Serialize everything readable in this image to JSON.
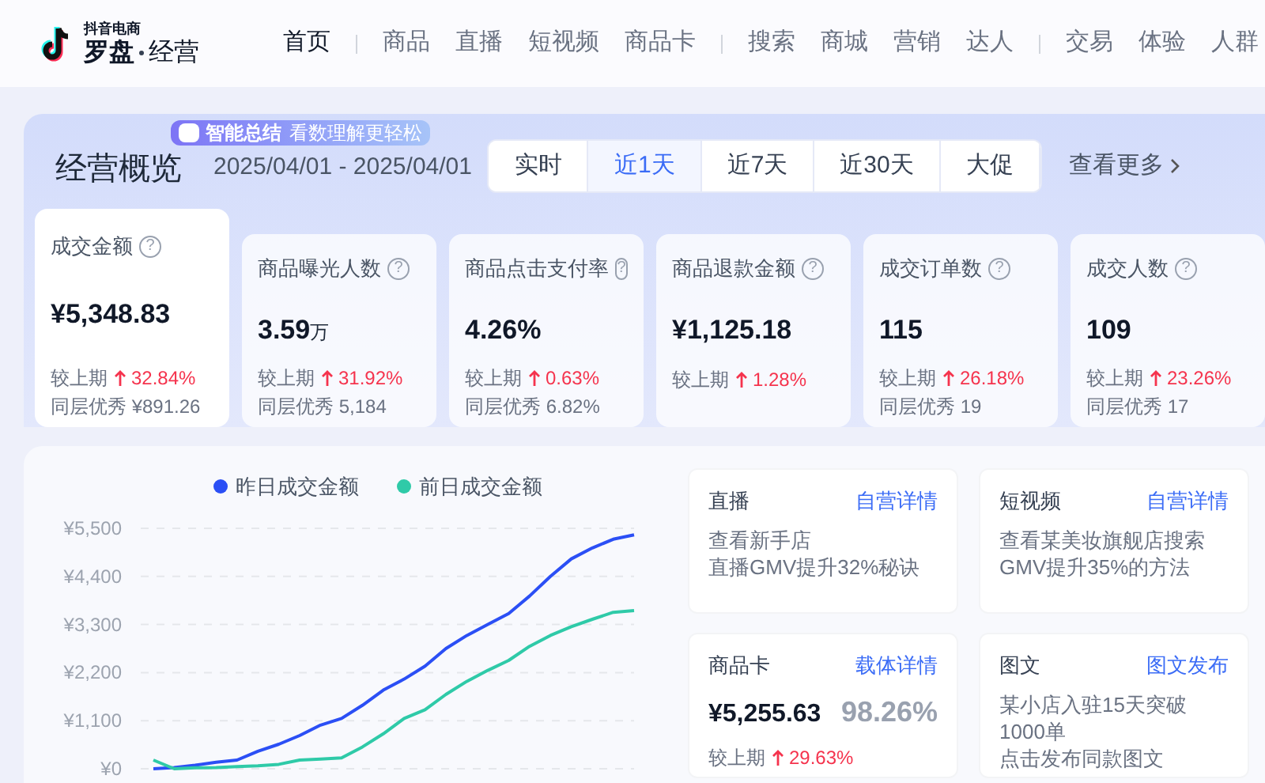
{
  "logo": {
    "top": "抖音电商",
    "main": "罗盘",
    "sub": "经营"
  },
  "nav_groups": [
    {
      "items": [
        {
          "label": "首页",
          "selected": true
        }
      ]
    },
    {
      "items": [
        {
          "label": "商品",
          "selected": false
        },
        {
          "label": "直播",
          "selected": false
        },
        {
          "label": "短视频",
          "selected": false
        },
        {
          "label": "商品卡",
          "selected": false
        }
      ]
    },
    {
      "items": [
        {
          "label": "搜索",
          "selected": false
        },
        {
          "label": "商城",
          "selected": false
        },
        {
          "label": "营销",
          "selected": false
        },
        {
          "label": "达人",
          "selected": false
        }
      ]
    },
    {
      "items": [
        {
          "label": "交易",
          "selected": false
        },
        {
          "label": "体验",
          "selected": false
        },
        {
          "label": "人群",
          "selected": false
        }
      ]
    }
  ],
  "overview": {
    "title": "经营概览",
    "badge": {
      "label": "智能总结",
      "hint": "看数理解更轻松"
    },
    "date_range": "2025/04/01 - 2025/04/01",
    "ranges": [
      {
        "label": "实时",
        "selected": false
      },
      {
        "label": "近1天",
        "selected": true
      },
      {
        "label": "近7天",
        "selected": false
      },
      {
        "label": "近30天",
        "selected": false
      },
      {
        "label": "大促",
        "selected": false
      }
    ],
    "more": "查看更多",
    "metrics": [
      {
        "label": "成交金额",
        "help": "?",
        "value": "¥5,348.83",
        "selected": true,
        "compare": "较上期",
        "change": "32.84%",
        "peer": "同层优秀 ¥891.26"
      },
      {
        "label": "商品曝光人数",
        "help": "?",
        "value": "3.59",
        "unit": "万",
        "selected": false,
        "compare": "较上期",
        "change": "31.92%",
        "peer": "同层优秀 5,184"
      },
      {
        "label": "商品点击支付率",
        "help": "?",
        "value": "4.26%",
        "selected": false,
        "compare": "较上期",
        "change": "0.63%",
        "peer": "同层优秀 6.82%"
      },
      {
        "label": "商品退款金额",
        "help": "?",
        "value": "¥1,125.18",
        "selected": false,
        "compare": "较上期",
        "change": "1.28%"
      },
      {
        "label": "成交订单数",
        "help": "?",
        "value": "115",
        "selected": false,
        "compare": "较上期",
        "change": "26.18%",
        "peer": "同层优秀 19"
      },
      {
        "label": "成交人数",
        "help": "?",
        "value": "109",
        "selected": false,
        "compare": "较上期",
        "change": "23.26%",
        "peer": "同层优秀 17"
      }
    ]
  },
  "chart_data": {
    "type": "line",
    "grid": true,
    "ylim": [
      0,
      5500
    ],
    "yticks": [
      {
        "value": 0,
        "label": "¥0"
      },
      {
        "value": 1100,
        "label": "¥1,100"
      },
      {
        "value": 2200,
        "label": "¥2,200"
      },
      {
        "value": 3300,
        "label": "¥3,300"
      },
      {
        "value": 4400,
        "label": "¥4,400"
      },
      {
        "value": 5500,
        "label": "¥5,500"
      }
    ],
    "series": [
      {
        "name": "昨日成交金额",
        "color": "#2b4ff5",
        "values": [
          0,
          30,
          80,
          150,
          200,
          400,
          560,
          760,
          1000,
          1150,
          1450,
          1800,
          2050,
          2350,
          2750,
          3050,
          3300,
          3550,
          3950,
          4400,
          4800,
          5050,
          5250,
          5350
        ]
      },
      {
        "name": "前日成交金额",
        "color": "#2fcaa8",
        "values": [
          200,
          0,
          20,
          30,
          50,
          70,
          100,
          200,
          220,
          250,
          500,
          800,
          1150,
          1350,
          1700,
          2000,
          2250,
          2480,
          2800,
          3050,
          3250,
          3420,
          3580,
          3620
        ]
      }
    ]
  },
  "cards": [
    {
      "kind": "text",
      "title": "直播",
      "link": "自营详情",
      "lines": [
        "查看新手店",
        "直播GMV提升32%秘诀"
      ]
    },
    {
      "kind": "text",
      "title": "短视频",
      "link": "自营详情",
      "lines": [
        "查看某美妆旗舰店搜索",
        "GMV提升35%的方法"
      ]
    },
    {
      "kind": "stat",
      "title": "商品卡",
      "link": "载体详情",
      "value": "¥5,255.63",
      "share": "98.26%",
      "compare": "较上期",
      "change": "29.63%"
    },
    {
      "kind": "text",
      "title": "图文",
      "link": "图文发布",
      "lines": [
        "某小店入驻15天突破1000单",
        "点击发布同款图文"
      ]
    }
  ]
}
